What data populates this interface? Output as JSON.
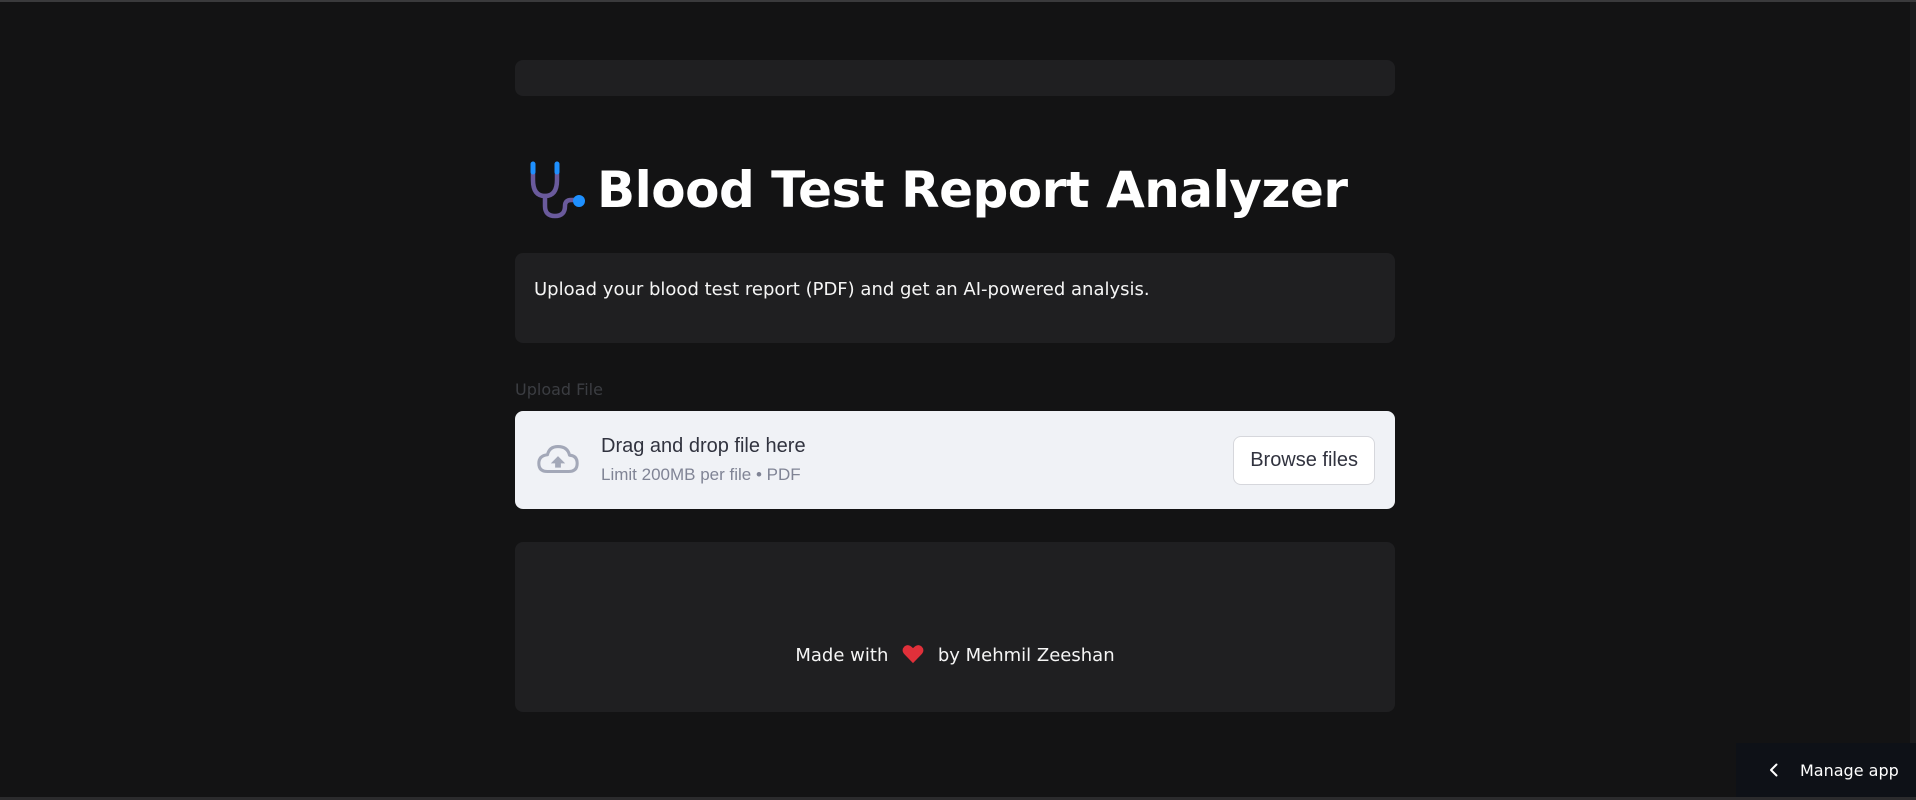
{
  "header": {
    "title": "Blood Test Report Analyzer",
    "icon": "stethoscope-icon"
  },
  "info": {
    "text": "Upload your blood test report (PDF) and get an AI-powered analysis."
  },
  "uploader": {
    "label": "Upload File",
    "main_text": "Drag and drop file here",
    "sub_text": "Limit 200MB per file • PDF",
    "button_label": "Browse files",
    "icon": "cloud-upload-icon"
  },
  "footer": {
    "prefix": "Made with",
    "suffix": "by Mehmil Zeeshan",
    "icon": "heart-icon"
  },
  "manage": {
    "label": "Manage app",
    "icon": "chevron-left-icon"
  },
  "colors": {
    "background": "#131314",
    "card": "#1f1f21",
    "dropzone": "#f0f2f6",
    "heart": "#e0303a",
    "stethoscope_tube": "#6a5a9c",
    "stethoscope_accent": "#1e90ff"
  }
}
